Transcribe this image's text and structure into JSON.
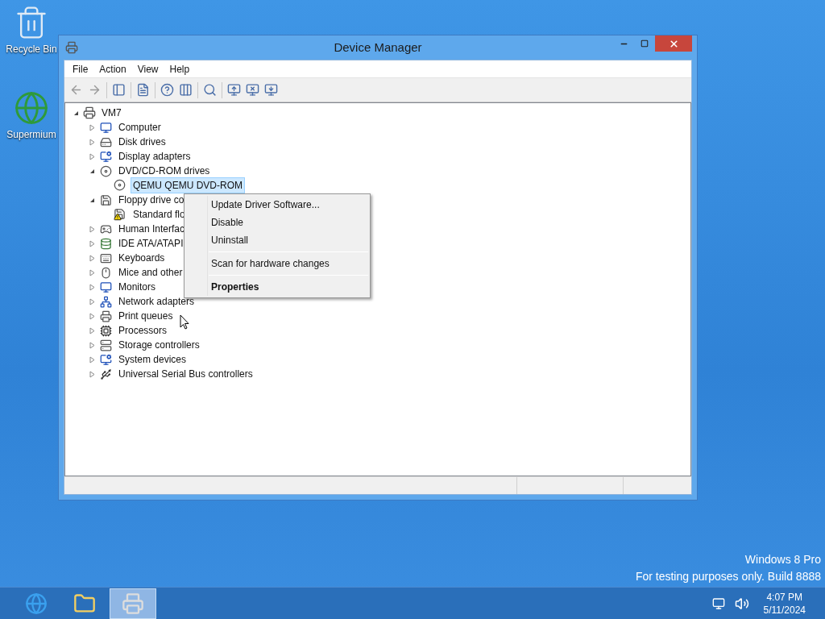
{
  "desktop_icons": [
    {
      "label": "Recycle Bin"
    },
    {
      "label": "Supermium"
    }
  ],
  "window": {
    "title": "Device Manager"
  },
  "menu_bar": [
    "File",
    "Action",
    "View",
    "Help"
  ],
  "tree": {
    "label": "VM7",
    "expanded": true,
    "children": [
      {
        "label": "Computer",
        "expanded": false,
        "selected": false
      },
      {
        "label": "Disk drives",
        "expanded": false,
        "selected": false
      },
      {
        "label": "Display adapters",
        "expanded": false,
        "selected": false
      },
      {
        "label": "DVD/CD-ROM drives",
        "expanded": true,
        "selected": false,
        "children": [
          {
            "label": "QEMU QEMU DVD-ROM",
            "selected": true,
            "warning": false
          }
        ]
      },
      {
        "label": "Floppy drive co",
        "expanded": true,
        "selected": false,
        "children": [
          {
            "label": "Standard flo",
            "selected": false,
            "warning": true
          }
        ]
      },
      {
        "label": "Human Interfac",
        "expanded": false,
        "selected": false
      },
      {
        "label": "IDE ATA/ATAPI",
        "expanded": false,
        "selected": false
      },
      {
        "label": "Keyboards",
        "expanded": false,
        "selected": false
      },
      {
        "label": "Mice and other",
        "expanded": false,
        "selected": false
      },
      {
        "label": "Monitors",
        "expanded": false,
        "selected": false
      },
      {
        "label": "Network adapters",
        "expanded": false,
        "selected": false
      },
      {
        "label": "Print queues",
        "expanded": false,
        "selected": false
      },
      {
        "label": "Processors",
        "expanded": false,
        "selected": false
      },
      {
        "label": "Storage controllers",
        "expanded": false,
        "selected": false
      },
      {
        "label": "System devices",
        "expanded": false,
        "selected": false
      },
      {
        "label": "Universal Serial Bus controllers",
        "expanded": false,
        "selected": false
      }
    ]
  },
  "context_menu": [
    {
      "kind": "item",
      "label": "Update Driver Software...",
      "default": false
    },
    {
      "kind": "item",
      "label": "Disable",
      "default": false
    },
    {
      "kind": "item",
      "label": "Uninstall",
      "default": false
    },
    {
      "kind": "separator"
    },
    {
      "kind": "item",
      "label": "Scan for hardware changes",
      "default": false
    },
    {
      "kind": "separator"
    },
    {
      "kind": "item",
      "label": "Properties",
      "default": true
    }
  ],
  "watermark": {
    "edition": "Windows 8 Pro",
    "build": "For testing purposes only. Build 8888"
  },
  "taskbar": {
    "apps": [
      {
        "selected": false
      },
      {
        "selected": false
      },
      {
        "selected": true
      }
    ],
    "time": "4:07 PM",
    "date": "5/11/2024"
  }
}
